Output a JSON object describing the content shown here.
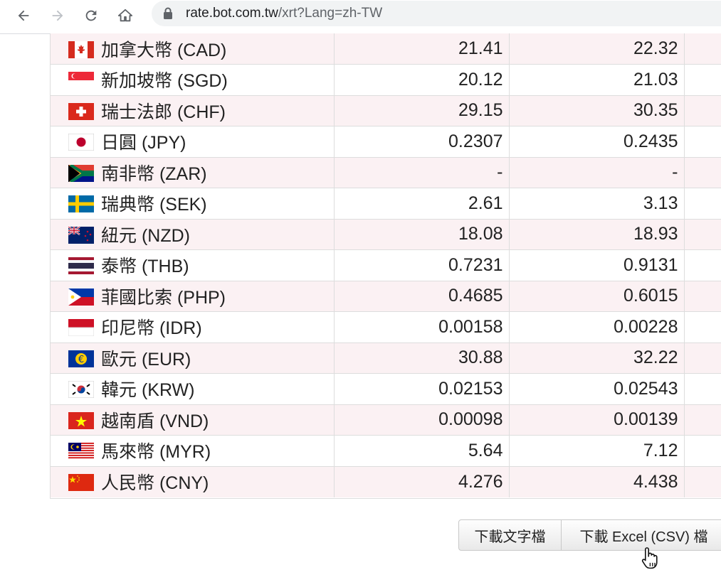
{
  "browser": {
    "url_host": "rate.bot.com.tw",
    "url_path": "/xrt?Lang=zh-TW"
  },
  "rates": [
    {
      "flag": "canada-flag-icon",
      "name": "加拿大幣 (CAD)",
      "buy": "21.41",
      "sell": "22.32"
    },
    {
      "flag": "singapore-flag-icon",
      "name": "新加坡幣 (SGD)",
      "buy": "20.12",
      "sell": "21.03"
    },
    {
      "flag": "switzerland-flag-icon",
      "name": "瑞士法郎 (CHF)",
      "buy": "29.15",
      "sell": "30.35"
    },
    {
      "flag": "japan-flag-icon",
      "name": "日圓 (JPY)",
      "buy": "0.2307",
      "sell": "0.2435"
    },
    {
      "flag": "south-africa-flag-icon",
      "name": "南非幣 (ZAR)",
      "buy": "-",
      "sell": "-"
    },
    {
      "flag": "sweden-flag-icon",
      "name": "瑞典幣 (SEK)",
      "buy": "2.61",
      "sell": "3.13"
    },
    {
      "flag": "new-zealand-flag-icon",
      "name": "紐元 (NZD)",
      "buy": "18.08",
      "sell": "18.93"
    },
    {
      "flag": "thailand-flag-icon",
      "name": "泰幣 (THB)",
      "buy": "0.7231",
      "sell": "0.9131"
    },
    {
      "flag": "philippines-flag-icon",
      "name": "菲國比索 (PHP)",
      "buy": "0.4685",
      "sell": "0.6015"
    },
    {
      "flag": "indonesia-flag-icon",
      "name": "印尼幣 (IDR)",
      "buy": "0.00158",
      "sell": "0.00228"
    },
    {
      "flag": "euro-flag-icon",
      "name": "歐元 (EUR)",
      "buy": "30.88",
      "sell": "32.22"
    },
    {
      "flag": "korea-flag-icon",
      "name": "韓元 (KRW)",
      "buy": "0.02153",
      "sell": "0.02543"
    },
    {
      "flag": "vietnam-flag-icon",
      "name": "越南盾 (VND)",
      "buy": "0.00098",
      "sell": "0.00139"
    },
    {
      "flag": "malaysia-flag-icon",
      "name": "馬來幣 (MYR)",
      "buy": "5.64",
      "sell": "7.12"
    },
    {
      "flag": "china-flag-icon",
      "name": "人民幣 (CNY)",
      "buy": "4.276",
      "sell": "4.438"
    }
  ],
  "buttons": {
    "download_text": "下載文字檔",
    "download_csv": "下載 Excel (CSV) 檔"
  }
}
